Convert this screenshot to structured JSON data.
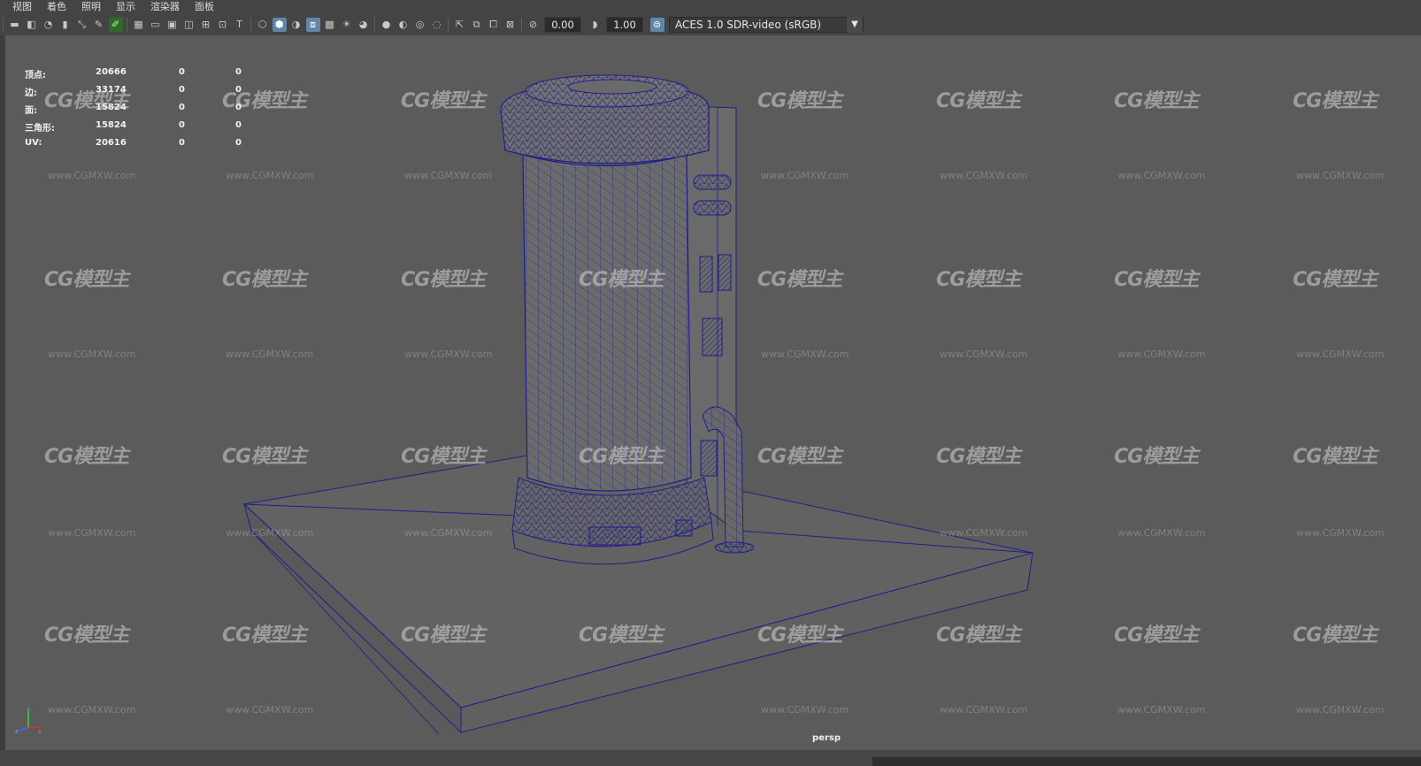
{
  "menubar": {
    "items": [
      "视图",
      "着色",
      "照明",
      "显示",
      "渲染器",
      "面板"
    ]
  },
  "toolbar": {
    "exposure_value": "0.00",
    "gamma_value": "1.00",
    "color_space": "ACES 1.0 SDR-video (sRGB)"
  },
  "hud": {
    "rows": [
      {
        "label": "顶点:",
        "values": [
          "20666",
          "0",
          "0"
        ]
      },
      {
        "label": "边:",
        "values": [
          "33174",
          "0",
          "0"
        ]
      },
      {
        "label": "面:",
        "values": [
          "15824",
          "0",
          "0"
        ]
      },
      {
        "label": "三角形:",
        "values": [
          "15824",
          "0",
          "0"
        ]
      },
      {
        "label": "UV:",
        "values": [
          "20616",
          "0",
          "0"
        ]
      }
    ]
  },
  "viewport": {
    "camera": "persp",
    "wireframe_color": "#1f1f8a",
    "background_color": "#5b5b5b"
  },
  "watermark": {
    "logo_text": "CG模型主",
    "url_text": "www.CGMXW.com"
  },
  "axis": {
    "x": "x",
    "y": "y",
    "z": "z"
  }
}
